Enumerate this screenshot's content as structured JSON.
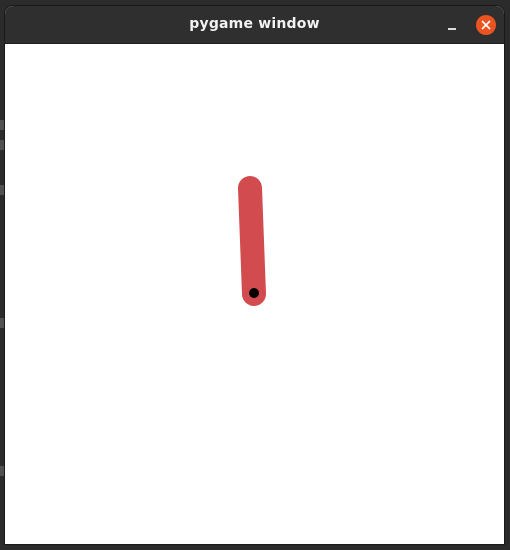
{
  "window": {
    "title": "pygame window"
  },
  "controls": {
    "minimize_icon": "minimize-icon",
    "close_icon": "close-icon",
    "close_color": "#e95420"
  },
  "game": {
    "canvas_color": "#ffffff",
    "pendulum": {
      "rod_color": "#d24b4f",
      "bob_color": "#000000"
    }
  }
}
